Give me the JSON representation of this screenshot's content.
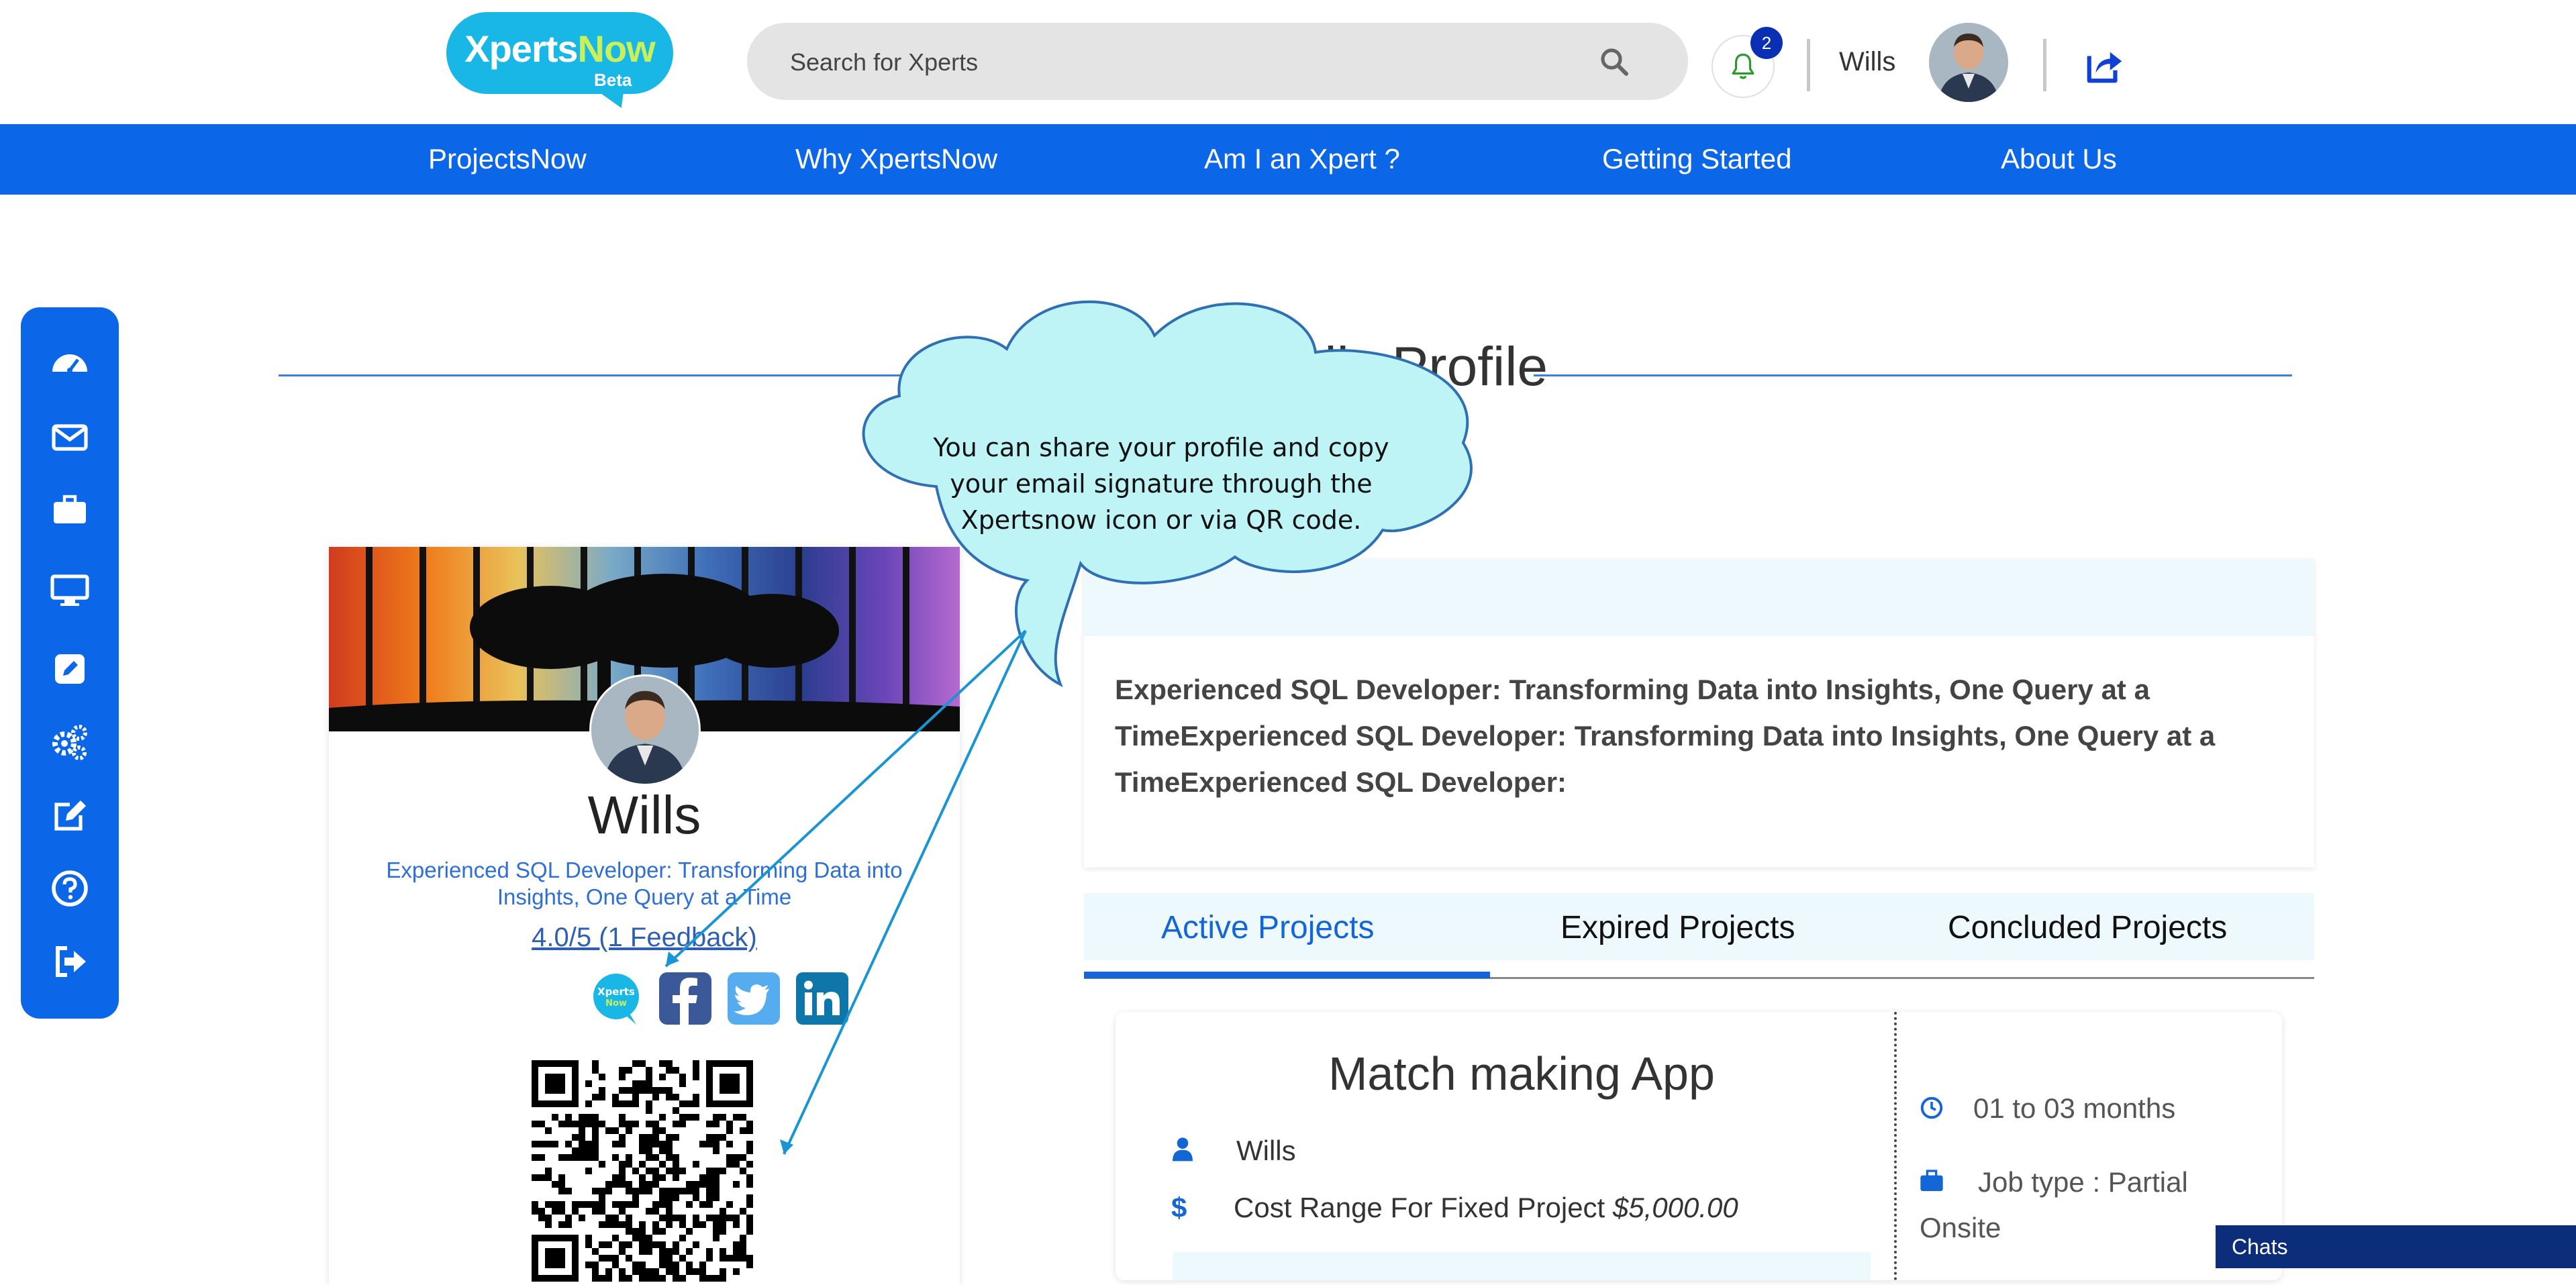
{
  "header": {
    "logo_text_a": "Xperts",
    "logo_text_b": "Now",
    "logo_beta": "Beta",
    "search_placeholder": "Search for Xperts",
    "notification_count": "2",
    "username": "Wills"
  },
  "nav": {
    "items": [
      "ProjectsNow",
      "Why XpertsNow",
      "Am I an Xpert ?",
      "Getting Started",
      "About Us"
    ]
  },
  "sidebar": {
    "icons": [
      "dashboard-icon",
      "mail-icon",
      "briefcase-icon",
      "monitor-icon",
      "edit-square-icon",
      "settings-icon",
      "edit-icon",
      "help-icon",
      "logout-icon"
    ]
  },
  "page": {
    "title": "Wills's Public Profile"
  },
  "profile": {
    "name": "Wills",
    "tagline": "Experienced SQL Developer: Transforming Data into Insights, One Query at a Time",
    "rating": "4.0/5 (1  Feedback)",
    "social": [
      "xpertsnow-icon",
      "facebook-icon",
      "twitter-icon",
      "linkedin-icon"
    ]
  },
  "about": {
    "text": "Experienced SQL Developer: Transforming Data into Insights, One Query at a TimeExperienced SQL Developer: Transforming Data into Insights, One Query at a TimeExperienced SQL Developer:"
  },
  "tabs": [
    "Active Projects",
    "Expired Projects",
    "Concluded Projects"
  ],
  "active_tab": 0,
  "project": {
    "title": "Match making App",
    "owner": "Wills",
    "cost_label": "Cost Range For Fixed Project ",
    "cost_value": "$5,000.00",
    "duration": "01 to 03 months",
    "job_type_label": "Job type :  Partial",
    "job_type_value": "Onsite"
  },
  "tooltip": {
    "text": "You can share your profile and copy your email signature through the Xpertsnow icon or via QR code."
  },
  "chats": {
    "label": "Chats"
  },
  "colors": {
    "brand_blue": "#0b66e8",
    "accent_teal": "#19b7e6",
    "tooltip_fill": "#bff4f6",
    "chats_bar": "#0b2d7a"
  }
}
